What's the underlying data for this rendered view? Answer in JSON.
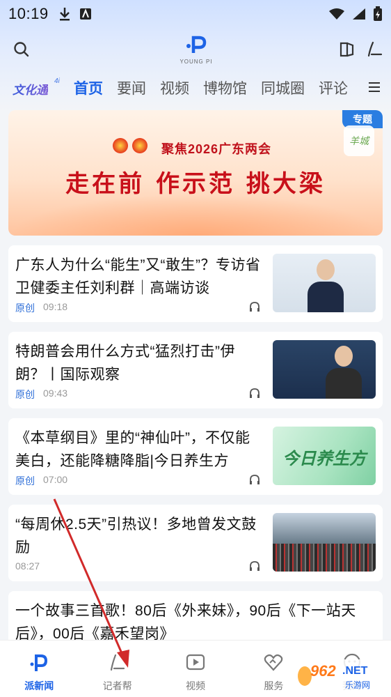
{
  "status_bar": {
    "time": "10:19"
  },
  "header": {
    "logo_sub": "YOUNG PI"
  },
  "tabs": {
    "brand": "文化通",
    "brand_sup": "4i",
    "items": [
      "首页",
      "要闻",
      "视频",
      "博物馆",
      "同城圈",
      "评论"
    ],
    "active_index": 0
  },
  "banner": {
    "tag": "专题",
    "seal_text": "羊城",
    "subtitle": "聚焦2026广东两会",
    "title": "走在前 作示范 挑大梁"
  },
  "articles": [
    {
      "title": "广东人为什么“能生”又“敢生”？专访省卫健委主任刘利群｜高端访谈",
      "source": "原创",
      "time": "09:18"
    },
    {
      "title": "特朗普会用什么方式“猛烈打击”伊朗？丨国际观察",
      "source": "原创",
      "time": "09:43"
    },
    {
      "title": "《本草纲目》里的“神仙叶”，不仅能美白，还能降糖降脂|今日养生方",
      "source": "原创",
      "time": "07:00",
      "thumb_text": "今日养生方"
    },
    {
      "title": "“每周休2.5天”引热议！多地曾发文鼓励",
      "source": "",
      "time": "08:27"
    },
    {
      "title": "一个故事三首歌！80后《外来妹》，90后《下一站天后》，00后《嘉禾望岗》",
      "source": "",
      "time": ""
    }
  ],
  "bottom_nav": {
    "items": [
      "派新闻",
      "记者帮",
      "视频",
      "服务",
      "我的"
    ],
    "active_index": 0
  },
  "watermark": {
    "num": "962",
    "net": ".NET",
    "cn": "乐游网"
  },
  "colors": {
    "accent": "#1d63e6",
    "banner_red": "#c8101a",
    "arrow": "#d12a2a"
  }
}
